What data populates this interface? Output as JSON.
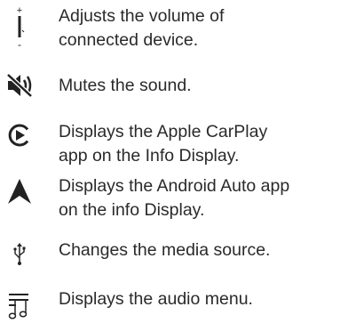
{
  "legend": [
    {
      "icon": "volume-knob-icon",
      "lines": [
        "Adjusts the volume of",
        "connected device."
      ]
    },
    {
      "icon": "mute-icon",
      "lines": [
        "Mutes the sound."
      ]
    },
    {
      "icon": "apple-carplay-icon",
      "lines": [
        "Displays the Apple CarPlay",
        "app on the Info Display."
      ]
    },
    {
      "icon": "android-auto-icon",
      "lines": [
        "Displays the Android Auto app",
        "on the info Display."
      ]
    },
    {
      "icon": "usb-icon",
      "lines": [
        "Changes the media source."
      ]
    },
    {
      "icon": "audio-menu-icon",
      "lines": [
        "Displays the audio menu."
      ]
    }
  ]
}
